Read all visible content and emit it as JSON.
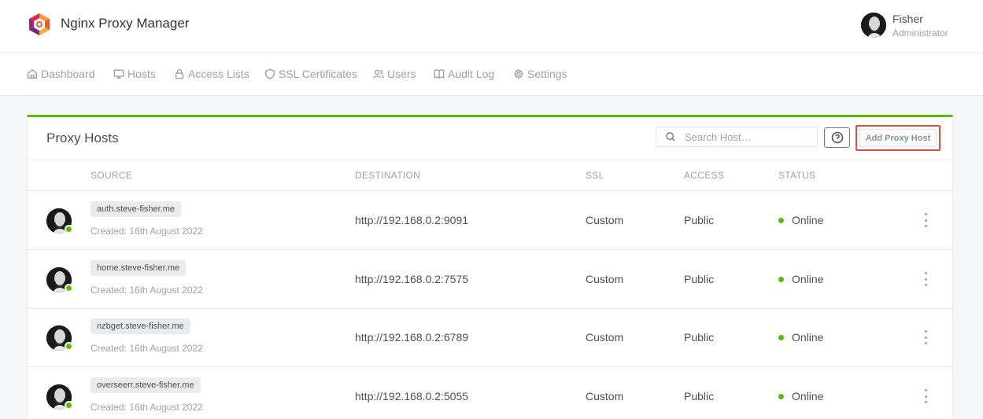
{
  "app": {
    "title": "Nginx Proxy Manager"
  },
  "user": {
    "name": "Fisher",
    "role": "Administrator"
  },
  "nav": [
    {
      "label": "Dashboard",
      "icon": "home-icon"
    },
    {
      "label": "Hosts",
      "icon": "monitor-icon"
    },
    {
      "label": "Access Lists",
      "icon": "lock-icon"
    },
    {
      "label": "SSL Certificates",
      "icon": "shield-icon"
    },
    {
      "label": "Users",
      "icon": "users-icon"
    },
    {
      "label": "Audit Log",
      "icon": "book-icon"
    },
    {
      "label": "Settings",
      "icon": "settings-icon"
    }
  ],
  "card": {
    "title": "Proxy Hosts",
    "search_placeholder": "Search Host…",
    "add_label": "Add Proxy Host",
    "accent_color": "#5eba00",
    "highlight_color": "#e04a3f"
  },
  "columns": {
    "source": "SOURCE",
    "destination": "DESTINATION",
    "ssl": "SSL",
    "access": "ACCESS",
    "status": "STATUS"
  },
  "rows": [
    {
      "domain": "auth.steve-fisher.me",
      "created": "Created: 16th August 2022",
      "destination": "http://192.168.0.2:9091",
      "ssl": "Custom",
      "access": "Public",
      "status": "Online"
    },
    {
      "domain": "home.steve-fisher.me",
      "created": "Created: 16th August 2022",
      "destination": "http://192.168.0.2:7575",
      "ssl": "Custom",
      "access": "Public",
      "status": "Online"
    },
    {
      "domain": "nzbget.steve-fisher.me",
      "created": "Created: 16th August 2022",
      "destination": "http://192.168.0.2:6789",
      "ssl": "Custom",
      "access": "Public",
      "status": "Online"
    },
    {
      "domain": "overseerr.steve-fisher.me",
      "created": "Created: 16th August 2022",
      "destination": "http://192.168.0.2:5055",
      "ssl": "Custom",
      "access": "Public",
      "status": "Online"
    }
  ]
}
